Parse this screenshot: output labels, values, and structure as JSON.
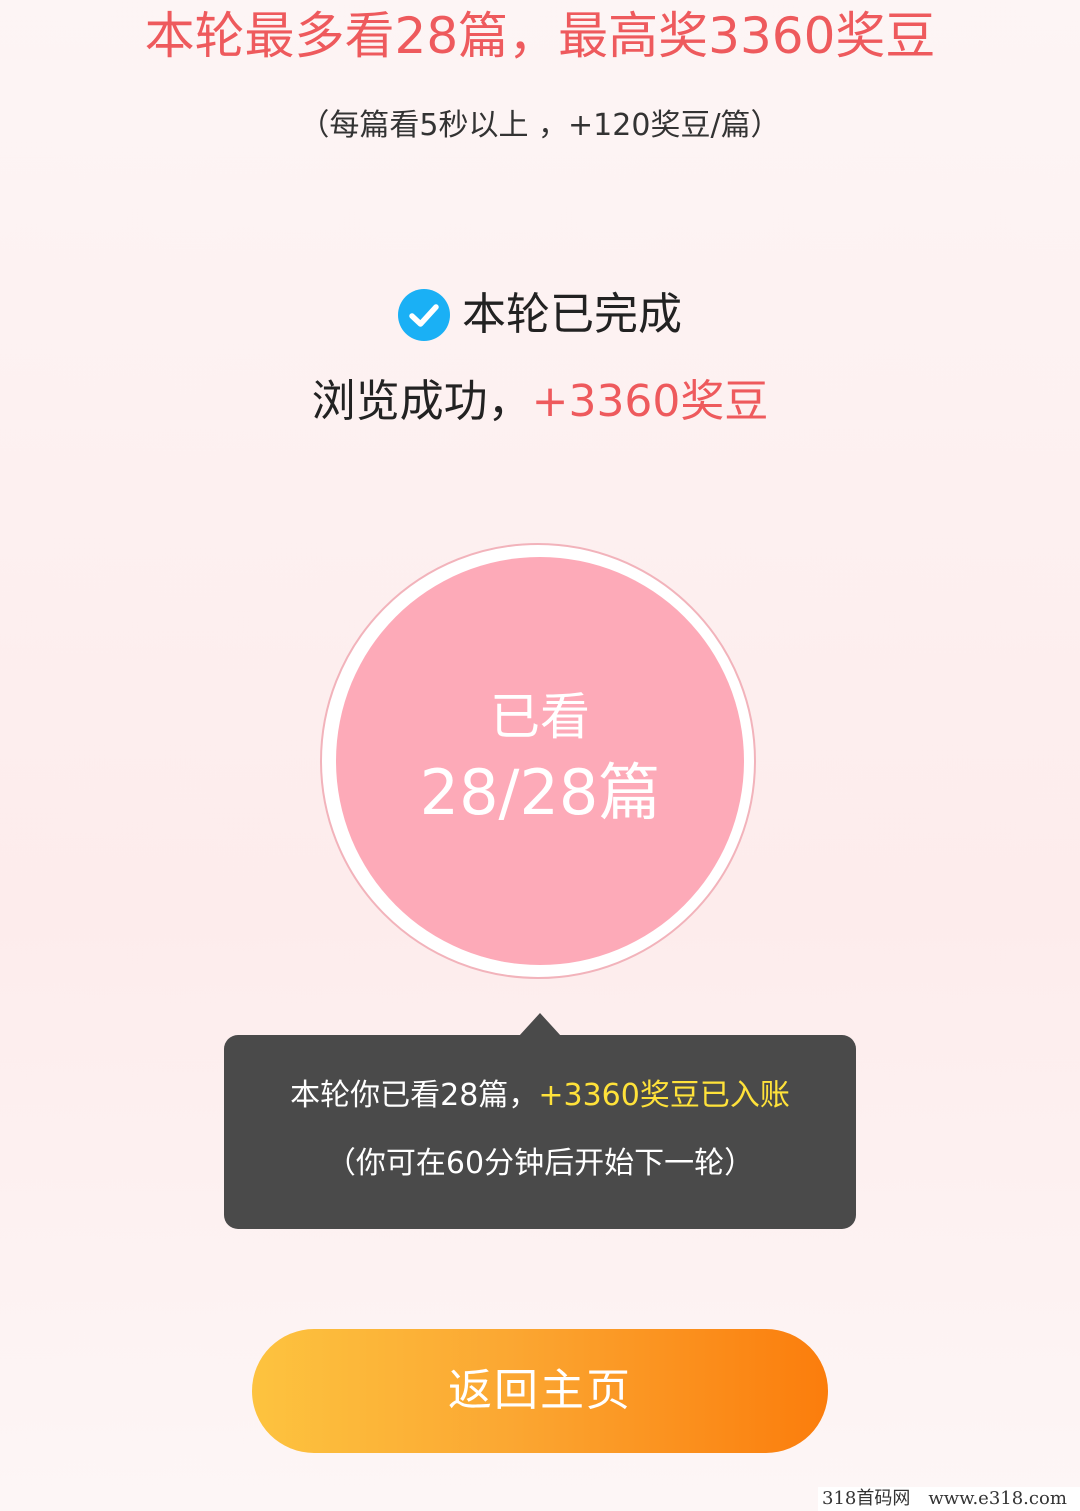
{
  "header": {
    "title": "本轮最多看28篇，最高奖3360奖豆",
    "subtitle": "（每篇看5秒以上 ，+120奖豆/篇）"
  },
  "status": {
    "icon": "check-circle-icon",
    "icon_color": "#1ab0f5",
    "completed_text": "本轮已完成",
    "reward_prefix": "浏览成功，",
    "reward_amount": "+3360奖豆"
  },
  "progress": {
    "label": "已看",
    "count_text": "28/28篇",
    "viewed": 28,
    "total": 28
  },
  "tooltip": {
    "line1_prefix": "本轮你已看28篇，",
    "line1_highlight": "+3360奖豆已入账",
    "line2": "（你可在60分钟后开始下一轮）"
  },
  "actions": {
    "home_button_label": "返回主页"
  },
  "watermark": {
    "brand": "318首码网",
    "url": "www.e318.com"
  },
  "colors": {
    "accent_red": "#ee5a5d",
    "circle_pink": "#fdaab8",
    "tooltip_bg": "#4a4a4a",
    "tooltip_highlight": "#ffe23a",
    "button_start": "#fdc33f",
    "button_end": "#fb7d0c"
  }
}
